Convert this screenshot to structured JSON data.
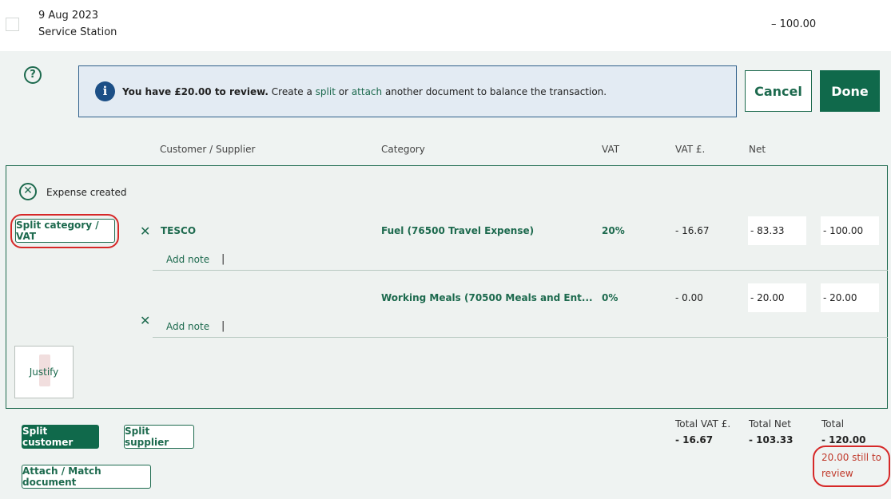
{
  "transaction": {
    "date": "9 Aug 2023",
    "name": "Service Station",
    "amount": "– 100.00"
  },
  "help": {
    "icon": "question-circle-icon",
    "glyph": "?"
  },
  "info_banner": {
    "icon_glyph": "i",
    "bold_text": "You have £20.00 to review.",
    "text_1": " Create a ",
    "link_split": "split",
    "text_2": " or ",
    "link_attach": "attach",
    "text_3": " another document to balance the transaction."
  },
  "actions": {
    "cancel_label": "Cancel",
    "done_label": "Done"
  },
  "columns": {
    "customer_supplier": "Customer / Supplier",
    "category": "Category",
    "vat": "VAT",
    "vat_amount": "VAT £.",
    "net": "Net"
  },
  "status": {
    "icon_glyph": "✕",
    "text": "Expense created"
  },
  "split_category_label": "Split category / VAT",
  "lines": [
    {
      "supplier": "TESCO",
      "category": "Fuel (76500 Travel Expense)",
      "vat_rate": "20%",
      "vat_amount": "- 16.67",
      "net": "- 83.33",
      "gross": "- 100.00",
      "add_note": "Add note",
      "caret": "|",
      "remove_glyph": "✕"
    },
    {
      "supplier": "",
      "category": "Working Meals (70500 Meals and Ent...",
      "vat_rate": "0%",
      "vat_amount": "- 0.00",
      "net": "- 20.00",
      "gross": "- 20.00",
      "add_note": "Add note",
      "caret": "|",
      "remove_glyph": "✕"
    }
  ],
  "justify_label": "Justify",
  "footer_buttons": {
    "split_customer": "Split customer",
    "split_supplier": "Split supplier",
    "attach_match": "Attach / Match document"
  },
  "totals": {
    "vat_label": "Total VAT £.",
    "vat_value": "- 16.67",
    "net_label": "Total Net",
    "net_value": "- 103.33",
    "total_label": "Total",
    "total_value": "- 120.00",
    "still_to_review": "20.00 still to review"
  },
  "colors": {
    "brand_green": "#10694b",
    "info_blue": "#1c4f86",
    "annotation_red": "#d62828",
    "warning_text": "#c0392b"
  }
}
